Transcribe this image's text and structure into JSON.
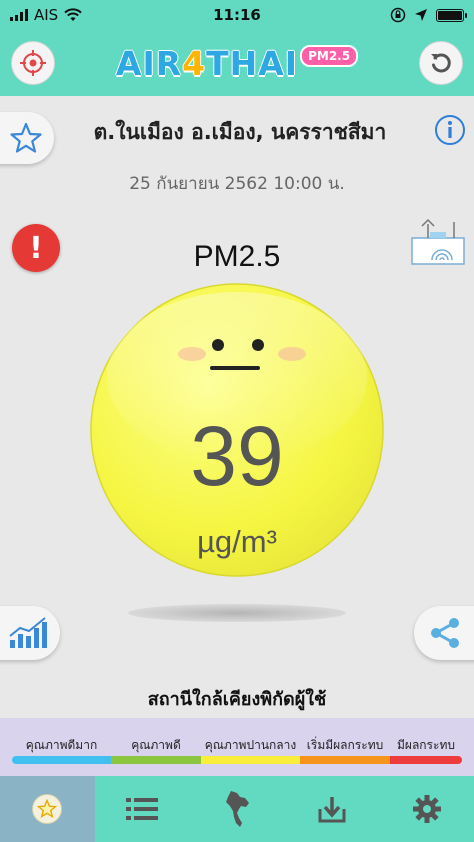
{
  "status_bar": {
    "carrier": "AIS",
    "time": "11:16"
  },
  "header": {
    "logo_prefix": "AIR",
    "logo_number": "4",
    "logo_suffix": "THAI",
    "logo_badge": "PM2.5"
  },
  "station": {
    "name": "ต.ในเมือง อ.เมือง, นครราชสีมา",
    "datetime": "25 กันยายน 2562 10:00 น."
  },
  "reading": {
    "label": "PM2.5",
    "value": "39",
    "unit": "µg/m³",
    "level_color": "#f5f542"
  },
  "nearby_label": "สถานีใกล้เคียงพิกัดผู้ใช้",
  "legend": {
    "items": [
      {
        "label": "คุณภาพดีมาก",
        "color": "#3fc0f0"
      },
      {
        "label": "คุณภาพดี",
        "color": "#8cc63f"
      },
      {
        "label": "คุณภาพปานกลาง",
        "color": "#f9ee3b"
      },
      {
        "label": "เริ่มมีผลกระทบ",
        "color": "#f7941d"
      },
      {
        "label": "มีผลกระทบ",
        "color": "#ee3b3b"
      }
    ]
  },
  "tabs": [
    {
      "icon": "favorite-star-icon",
      "active": true
    },
    {
      "icon": "list-icon",
      "active": false
    },
    {
      "icon": "thailand-map-icon",
      "active": false
    },
    {
      "icon": "download-icon",
      "active": false
    },
    {
      "icon": "settings-gear-icon",
      "active": false
    }
  ],
  "colors": {
    "header_bg": "#62d9c1",
    "accent_blue": "#2da8e3",
    "legend_bg": "#d9d3ee",
    "alert_red": "#e53935"
  }
}
